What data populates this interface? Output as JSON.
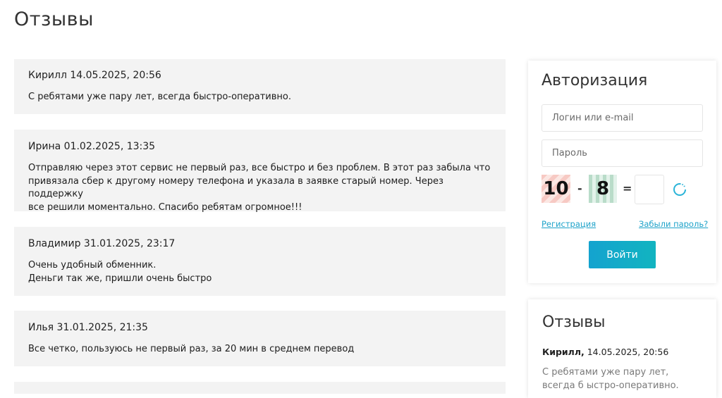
{
  "page": {
    "title": "Отзывы"
  },
  "reviews": [
    {
      "name": "Кирилл",
      "date": "14.05.2025, 20:56",
      "text": "С ребятами уже пару лет, всегда быстро-оперативно."
    },
    {
      "name": "Ирина",
      "date": "01.02.2025, 13:35",
      "text": "Отправляю через этот сервис не первый раз, все быстро и без проблем. В этот раз забыла что\nпривязала сбер к другому номеру телефона и указала в заявке старый номер. Через поддержку\nвсе решили моментально. Спасибо ребятам огромное!!!"
    },
    {
      "name": "Владимир",
      "date": "31.01.2025, 23:17",
      "text": "Очень удобный обменник.\nДеньги так же, пришли очень быстро"
    },
    {
      "name": "Илья",
      "date": "31.01.2025, 21:35",
      "text": "Все четко, пользуюсь не первый раз, за 20 мин в среднем перевод"
    }
  ],
  "auth": {
    "title": "Авторизация",
    "login_placeholder": "Логин или e-mail",
    "password_placeholder": "Пароль",
    "captcha": {
      "a": "10",
      "op": "-",
      "b": "8",
      "eq": "="
    },
    "register_link": "Регистрация",
    "forgot_link": "Забыли пароль?",
    "login_button": "Войти",
    "accent_color": "#14a3cf"
  },
  "side_reviews": {
    "title": "Отзывы",
    "item": {
      "name": "Кирилл,",
      "date": "14.05.2025, 20:56",
      "text": "С ребятами уже пару лет, всегда б ыстро-оперативно."
    }
  }
}
